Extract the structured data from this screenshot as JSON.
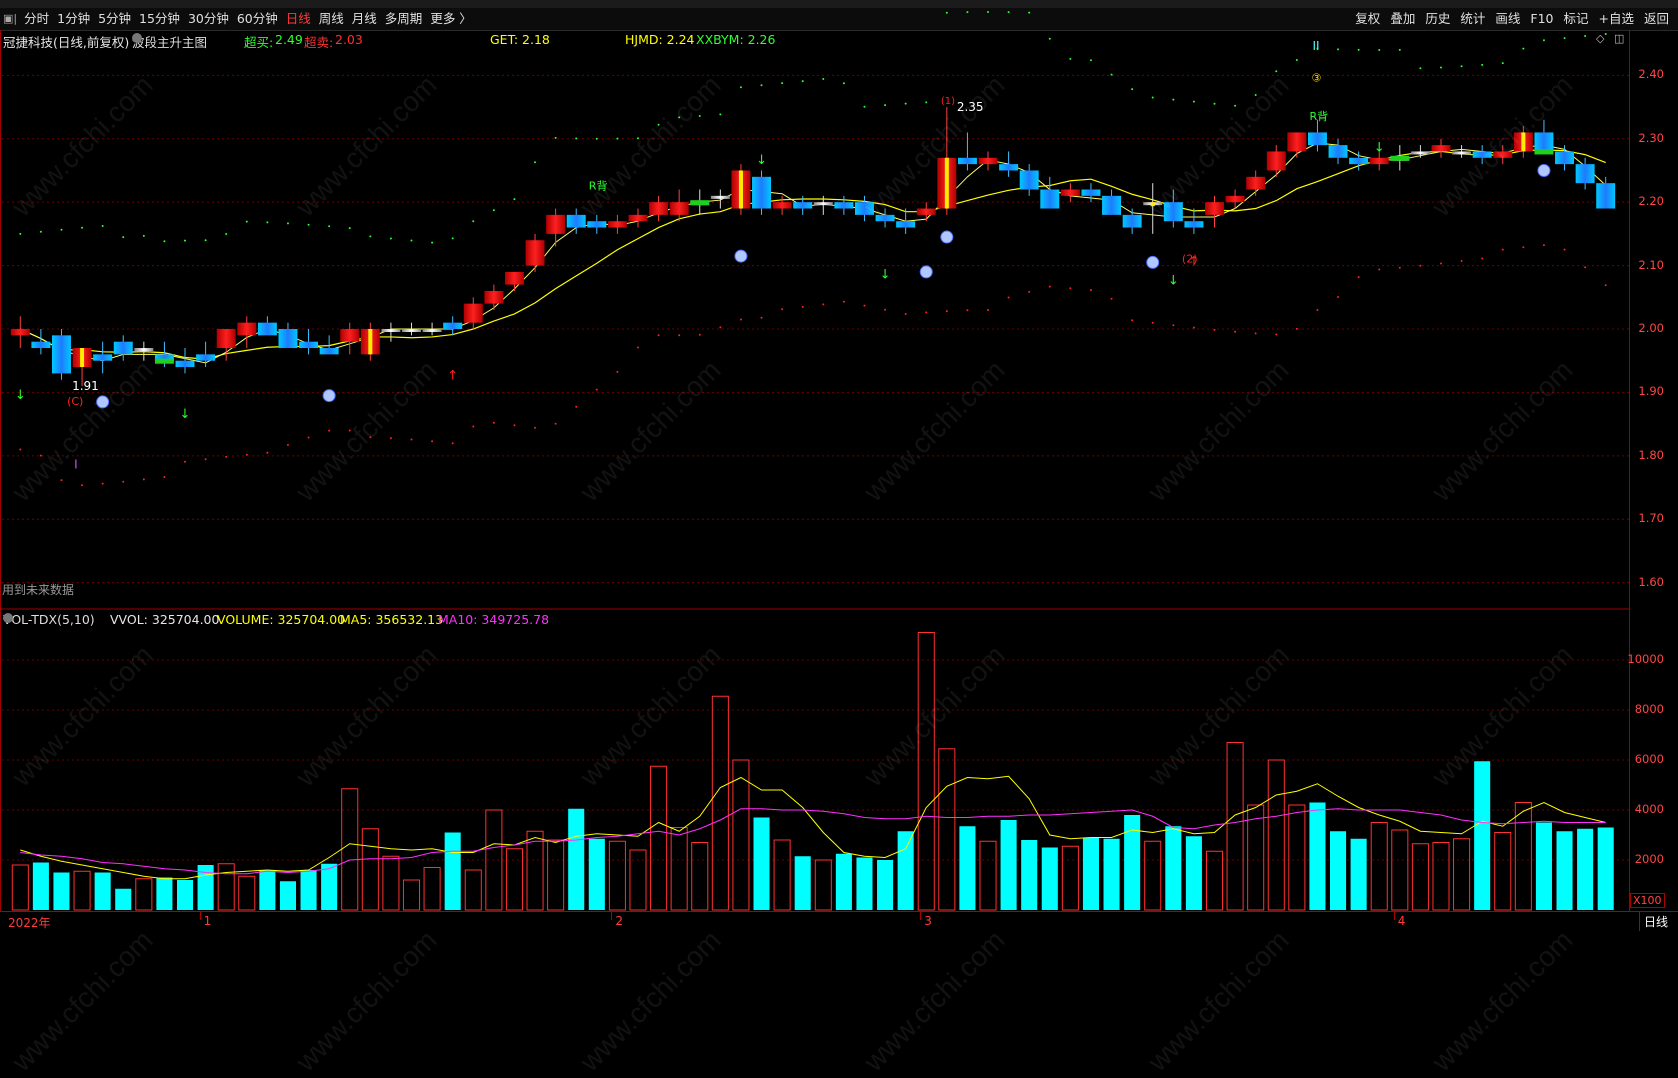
{
  "toolbar": {
    "logo_icon": "app-logo-icon",
    "periods": [
      "分时",
      "1分钟",
      "5分钟",
      "15分钟",
      "30分钟",
      "60分钟",
      "日线",
      "周线",
      "月线",
      "多周期",
      "更多 〉"
    ],
    "active_period": "日线",
    "right_buttons": [
      "复权",
      "叠加",
      "历史",
      "统计",
      "画线",
      "F10",
      "标记",
      "+自选",
      "返回"
    ]
  },
  "main_header": {
    "stock_title": "冠捷科技(日线,前复权)",
    "indicator_name": "波段主升主图",
    "chaomai_label": "超买:",
    "chaomai_value": "2.49",
    "chaomai2_label": "超卖:",
    "chaomai2_value": "2.03",
    "get_label": "GET: 2.18",
    "hjmd_label": "HJMD: 2.24",
    "xxbym_label": "XXBYM: 2.26",
    "future_note": "用到未来数据"
  },
  "vol_header": {
    "name": "VOL-TDX(5,10)",
    "vvol": "VVOL: 325704.00",
    "volume": "VOLUME: 325704.00",
    "ma5": "MA5: 356532.13",
    "ma10": "MA10: 349725.78"
  },
  "price_axis": [
    "2.40",
    "2.30",
    "2.20",
    "2.10",
    "2.00",
    "1.90",
    "1.80",
    "1.70",
    "1.60"
  ],
  "volume_axis": [
    "10000",
    "8000",
    "6000",
    "4000",
    "2000"
  ],
  "volume_unit": "X100",
  "month_labels": [
    "2022年",
    "1",
    "2",
    "3",
    "4"
  ],
  "period_tag": "日线",
  "annotations": {
    "low_mark": "1.91",
    "high_mark": "2.35",
    "r_back": "R背",
    "roman_1": "I",
    "roman_2": "II",
    "circle_3": "③",
    "circle_1": "(1)",
    "circle_2": "(2)",
    "c_mark": "(C)"
  },
  "colors": {
    "up": "#ff1a1a",
    "down": "#1e9bff",
    "cyan": "#00ffff",
    "ma_yellow": "#ffff00",
    "ma_magenta": "#ff00ff",
    "grid": "#7a0000"
  },
  "watermark": "www.cfchi.com",
  "chart_data": {
    "type": "candlestick",
    "price_ylim": [
      1.56,
      2.44
    ],
    "volume_ylim": [
      0,
      11200
    ],
    "candles": [
      [
        1.99,
        2.02,
        1.97,
        2.0
      ],
      [
        1.98,
        2.0,
        1.96,
        1.97
      ],
      [
        1.99,
        2.0,
        1.92,
        1.93
      ],
      [
        1.94,
        1.97,
        1.91,
        1.97
      ],
      [
        1.96,
        1.98,
        1.93,
        1.95
      ],
      [
        1.98,
        1.99,
        1.95,
        1.96
      ],
      [
        1.97,
        1.98,
        1.95,
        1.97
      ],
      [
        1.96,
        1.98,
        1.94,
        1.95
      ],
      [
        1.95,
        1.97,
        1.93,
        1.94
      ],
      [
        1.96,
        1.98,
        1.94,
        1.95
      ],
      [
        1.97,
        2.0,
        1.95,
        2.0
      ],
      [
        1.99,
        2.02,
        1.97,
        2.01
      ],
      [
        2.01,
        2.02,
        1.99,
        1.99
      ],
      [
        2.0,
        2.01,
        1.97,
        1.97
      ],
      [
        1.98,
        2.0,
        1.96,
        1.97
      ],
      [
        1.97,
        1.99,
        1.96,
        1.96
      ],
      [
        1.98,
        2.01,
        1.96,
        2.0
      ],
      [
        1.96,
        2.01,
        1.95,
        2.0
      ],
      [
        2.0,
        2.01,
        1.98,
        2.0
      ],
      [
        2.0,
        2.01,
        1.99,
        2.0
      ],
      [
        2.0,
        2.01,
        1.99,
        2.0
      ],
      [
        2.01,
        2.02,
        1.99,
        2.0
      ],
      [
        2.01,
        2.05,
        2.0,
        2.04
      ],
      [
        2.04,
        2.07,
        2.03,
        2.06
      ],
      [
        2.07,
        2.09,
        2.06,
        2.09
      ],
      [
        2.1,
        2.15,
        2.09,
        2.14
      ],
      [
        2.15,
        2.19,
        2.13,
        2.18
      ],
      [
        2.18,
        2.19,
        2.15,
        2.16
      ],
      [
        2.17,
        2.18,
        2.15,
        2.16
      ],
      [
        2.16,
        2.18,
        2.15,
        2.17
      ],
      [
        2.17,
        2.19,
        2.16,
        2.18
      ],
      [
        2.18,
        2.21,
        2.17,
        2.2
      ],
      [
        2.18,
        2.22,
        2.17,
        2.2
      ],
      [
        2.2,
        2.22,
        2.18,
        2.2
      ],
      [
        2.21,
        2.22,
        2.19,
        2.21
      ],
      [
        2.19,
        2.26,
        2.18,
        2.25
      ],
      [
        2.24,
        2.25,
        2.18,
        2.19
      ],
      [
        2.19,
        2.21,
        2.18,
        2.2
      ],
      [
        2.2,
        2.21,
        2.18,
        2.19
      ],
      [
        2.2,
        2.21,
        2.18,
        2.2
      ],
      [
        2.2,
        2.21,
        2.18,
        2.19
      ],
      [
        2.2,
        2.21,
        2.17,
        2.18
      ],
      [
        2.18,
        2.19,
        2.16,
        2.17
      ],
      [
        2.17,
        2.19,
        2.15,
        2.16
      ],
      [
        2.18,
        2.2,
        2.17,
        2.19
      ],
      [
        2.19,
        2.35,
        2.18,
        2.27
      ],
      [
        2.27,
        2.31,
        2.25,
        2.26
      ],
      [
        2.26,
        2.28,
        2.25,
        2.27
      ],
      [
        2.26,
        2.28,
        2.24,
        2.25
      ],
      [
        2.25,
        2.26,
        2.21,
        2.22
      ],
      [
        2.22,
        2.24,
        2.19,
        2.19
      ],
      [
        2.21,
        2.23,
        2.2,
        2.22
      ],
      [
        2.22,
        2.23,
        2.2,
        2.21
      ],
      [
        2.21,
        2.22,
        2.18,
        2.18
      ],
      [
        2.18,
        2.19,
        2.15,
        2.16
      ],
      [
        2.2,
        2.23,
        2.15,
        2.2
      ],
      [
        2.2,
        2.22,
        2.16,
        2.17
      ],
      [
        2.17,
        2.19,
        2.15,
        2.16
      ],
      [
        2.18,
        2.21,
        2.16,
        2.2
      ],
      [
        2.2,
        2.22,
        2.19,
        2.21
      ],
      [
        2.22,
        2.25,
        2.21,
        2.24
      ],
      [
        2.25,
        2.29,
        2.24,
        2.28
      ],
      [
        2.28,
        2.31,
        2.27,
        2.31
      ],
      [
        2.31,
        2.33,
        2.28,
        2.29
      ],
      [
        2.29,
        2.3,
        2.26,
        2.27
      ],
      [
        2.27,
        2.28,
        2.25,
        2.26
      ],
      [
        2.26,
        2.28,
        2.25,
        2.27
      ],
      [
        2.27,
        2.29,
        2.25,
        2.27
      ],
      [
        2.28,
        2.29,
        2.27,
        2.28
      ],
      [
        2.28,
        2.3,
        2.27,
        2.29
      ],
      [
        2.28,
        2.29,
        2.27,
        2.28
      ],
      [
        2.28,
        2.29,
        2.26,
        2.27
      ],
      [
        2.27,
        2.29,
        2.26,
        2.28
      ],
      [
        2.28,
        2.32,
        2.27,
        2.31
      ],
      [
        2.31,
        2.33,
        2.28,
        2.28
      ],
      [
        2.28,
        2.29,
        2.25,
        2.26
      ],
      [
        2.26,
        2.27,
        2.22,
        2.23
      ],
      [
        2.23,
        2.24,
        2.19,
        2.19
      ]
    ],
    "volumes": [
      1800,
      1900,
      1500,
      1550,
      1500,
      850,
      1250,
      1300,
      1200,
      1800,
      1850,
      1350,
      1600,
      1150,
      1600,
      1850,
      4850,
      3250,
      2150,
      1200,
      1700,
      3100,
      1600,
      4000,
      2450,
      3150,
      2800,
      4050,
      2850,
      2750,
      2400,
      5750,
      3300,
      2700,
      8550,
      6000,
      3700,
      2800,
      2150,
      2000,
      2250,
      2100,
      2000,
      3150,
      11100,
      6450,
      3350,
      2750,
      3600,
      2800,
      2500,
      2550,
      2900,
      2850,
      3800,
      2750,
      3350,
      2950,
      2350,
      6700,
      4200,
      6000,
      4200,
      4300,
      3150,
      2850,
      3500,
      3200,
      2650,
      2700,
      2850,
      5950,
      3100,
      4300,
      3500,
      3150,
      3250,
      3300
    ],
    "ma5_volume": [
      2400,
      2150,
      1950,
      1800,
      1650,
      1500,
      1350,
      1250,
      1250,
      1400,
      1500,
      1550,
      1600,
      1550,
      1600,
      2100,
      2650,
      2550,
      2450,
      2400,
      2450,
      2300,
      2300,
      2650,
      2600,
      2900,
      2700,
      2950,
      3050,
      3000,
      2950,
      3500,
      3150,
      3750,
      4900,
      5300,
      4800,
      4800,
      4100,
      3100,
      2300,
      2150,
      2100,
      2450,
      4100,
      4950,
      5300,
      5250,
      5350,
      4450,
      3000,
      2850,
      2900,
      2900,
      3200,
      3100,
      3250,
      3050,
      3100,
      3800,
      4100,
      4600,
      4750,
      5050,
      4550,
      4100,
      3800,
      3550,
      3150,
      3100,
      3050,
      3550,
      3350,
      3950,
      4300,
      3900,
      3700,
      3500
    ],
    "ma10_volume": [
      2300,
      2200,
      2150,
      2050,
      1900,
      1850,
      1750,
      1650,
      1600,
      1500,
      1450,
      1450,
      1550,
      1500,
      1550,
      1650,
      2000,
      2050,
      2050,
      2100,
      2300,
      2350,
      2350,
      2500,
      2600,
      2750,
      2750,
      2800,
      2900,
      2950,
      3050,
      3150,
      3000,
      3250,
      3600,
      4050,
      4050,
      4000,
      4000,
      3950,
      3850,
      3700,
      3650,
      3650,
      3750,
      3700,
      3700,
      3750,
      3750,
      3800,
      3800,
      3850,
      3900,
      3950,
      4000,
      3750,
      3300,
      3250,
      3400,
      3500,
      3650,
      3750,
      3900,
      4000,
      4050,
      4000,
      4000,
      4000,
      3900,
      3800,
      3600,
      3500,
      3450,
      3500,
      3550,
      3500,
      3500,
      3500
    ]
  }
}
